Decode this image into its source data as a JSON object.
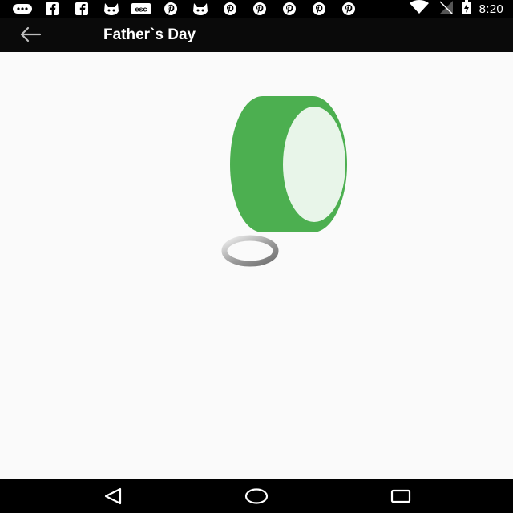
{
  "status_bar": {
    "time": "8:20",
    "left_icons": [
      "messaging-icon",
      "facebook-icon",
      "facebook-icon",
      "cat-icon",
      "esc-icon",
      "pinterest-icon",
      "cat-icon",
      "pinterest-icon",
      "pinterest-icon",
      "pinterest-icon",
      "pinterest-icon",
      "pinterest-icon"
    ],
    "right_icons": [
      "wifi-icon",
      "signal-icon",
      "battery-charging-icon"
    ]
  },
  "app_bar": {
    "title": "Father`s Day",
    "back_icon": "arrow-back-icon"
  },
  "content": {
    "graphic": "green-drum-illustration",
    "loading": "loading-spinner"
  },
  "nav_bar": {
    "buttons": [
      "back-triangle-icon",
      "home-circle-icon",
      "recents-square-icon"
    ]
  },
  "colors": {
    "status_bar": "#000000",
    "app_bar": "#0a0a0a",
    "background": "#fafafa",
    "drum_green": "#4caf50",
    "drum_face": "#e8f5e9",
    "spinner_gray": "#9e9e9e"
  }
}
